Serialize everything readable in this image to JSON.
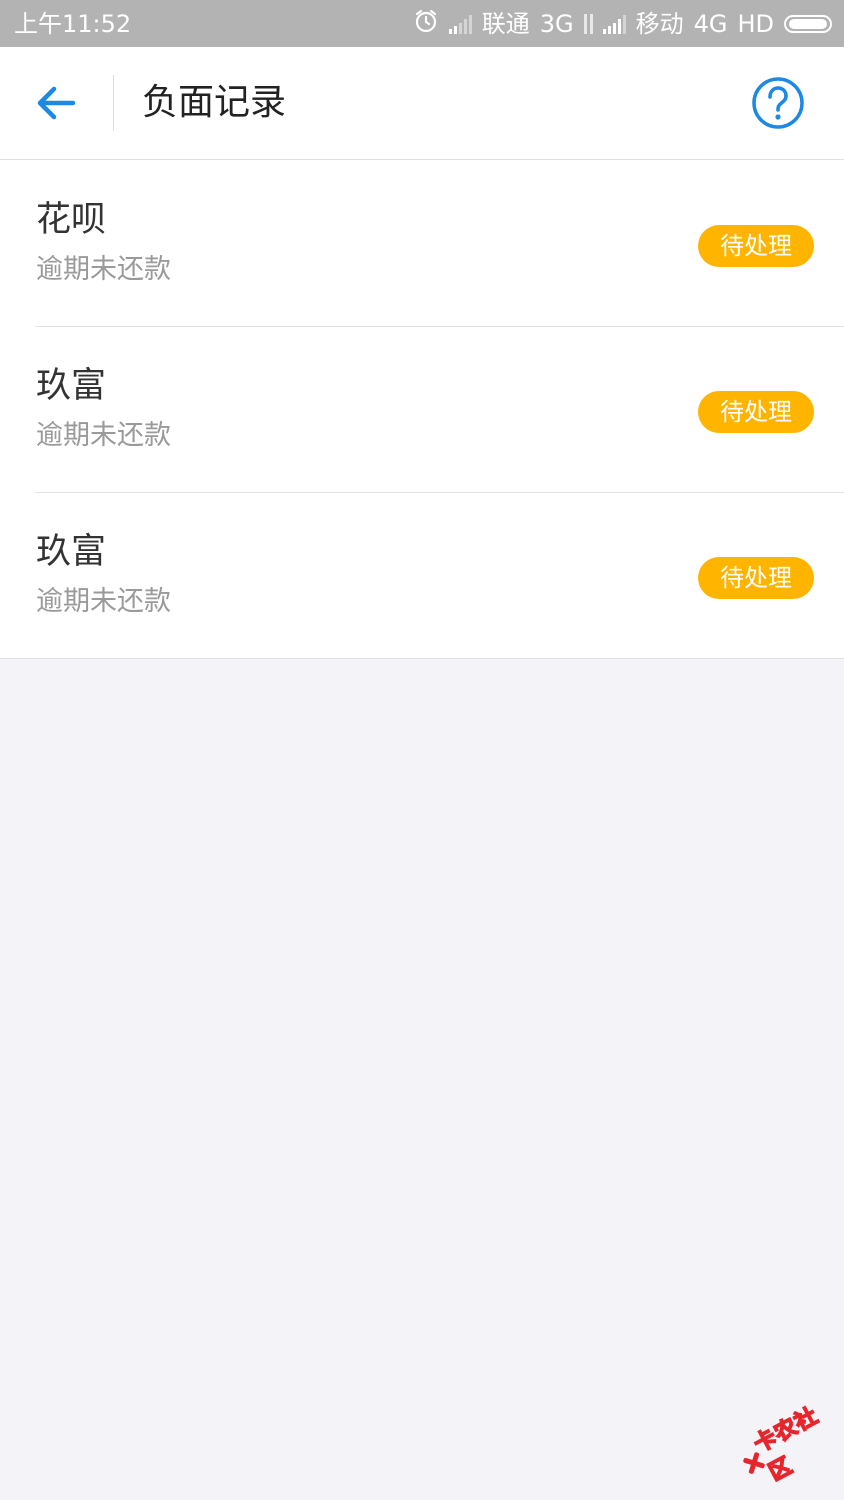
{
  "status_bar": {
    "time": "上午11:52",
    "carrier1": "联通",
    "network1": "3G",
    "carrier2": "移动",
    "network2": "4G",
    "hd": "HD",
    "icons": [
      "alarm-clock-icon",
      "signal-icon",
      "data-arrows-icon",
      "battery-icon"
    ]
  },
  "header": {
    "back_icon": "arrow-left-icon",
    "title": "负面记录",
    "help_icon": "question-circle-icon"
  },
  "records": [
    {
      "name": "花呗",
      "desc": "逾期未还款",
      "status": "待处理"
    },
    {
      "name": "玖富",
      "desc": "逾期未还款",
      "status": "待处理"
    },
    {
      "name": "玖富",
      "desc": "逾期未还款",
      "status": "待处理"
    }
  ],
  "watermark": {
    "text": "卡农社区"
  },
  "colors": {
    "accent_blue": "#1e88e5",
    "status_orange": "#ffb400",
    "background": "#f3f3f8",
    "status_bar": "#b3b3b3",
    "watermark_red": "#e6262c"
  }
}
